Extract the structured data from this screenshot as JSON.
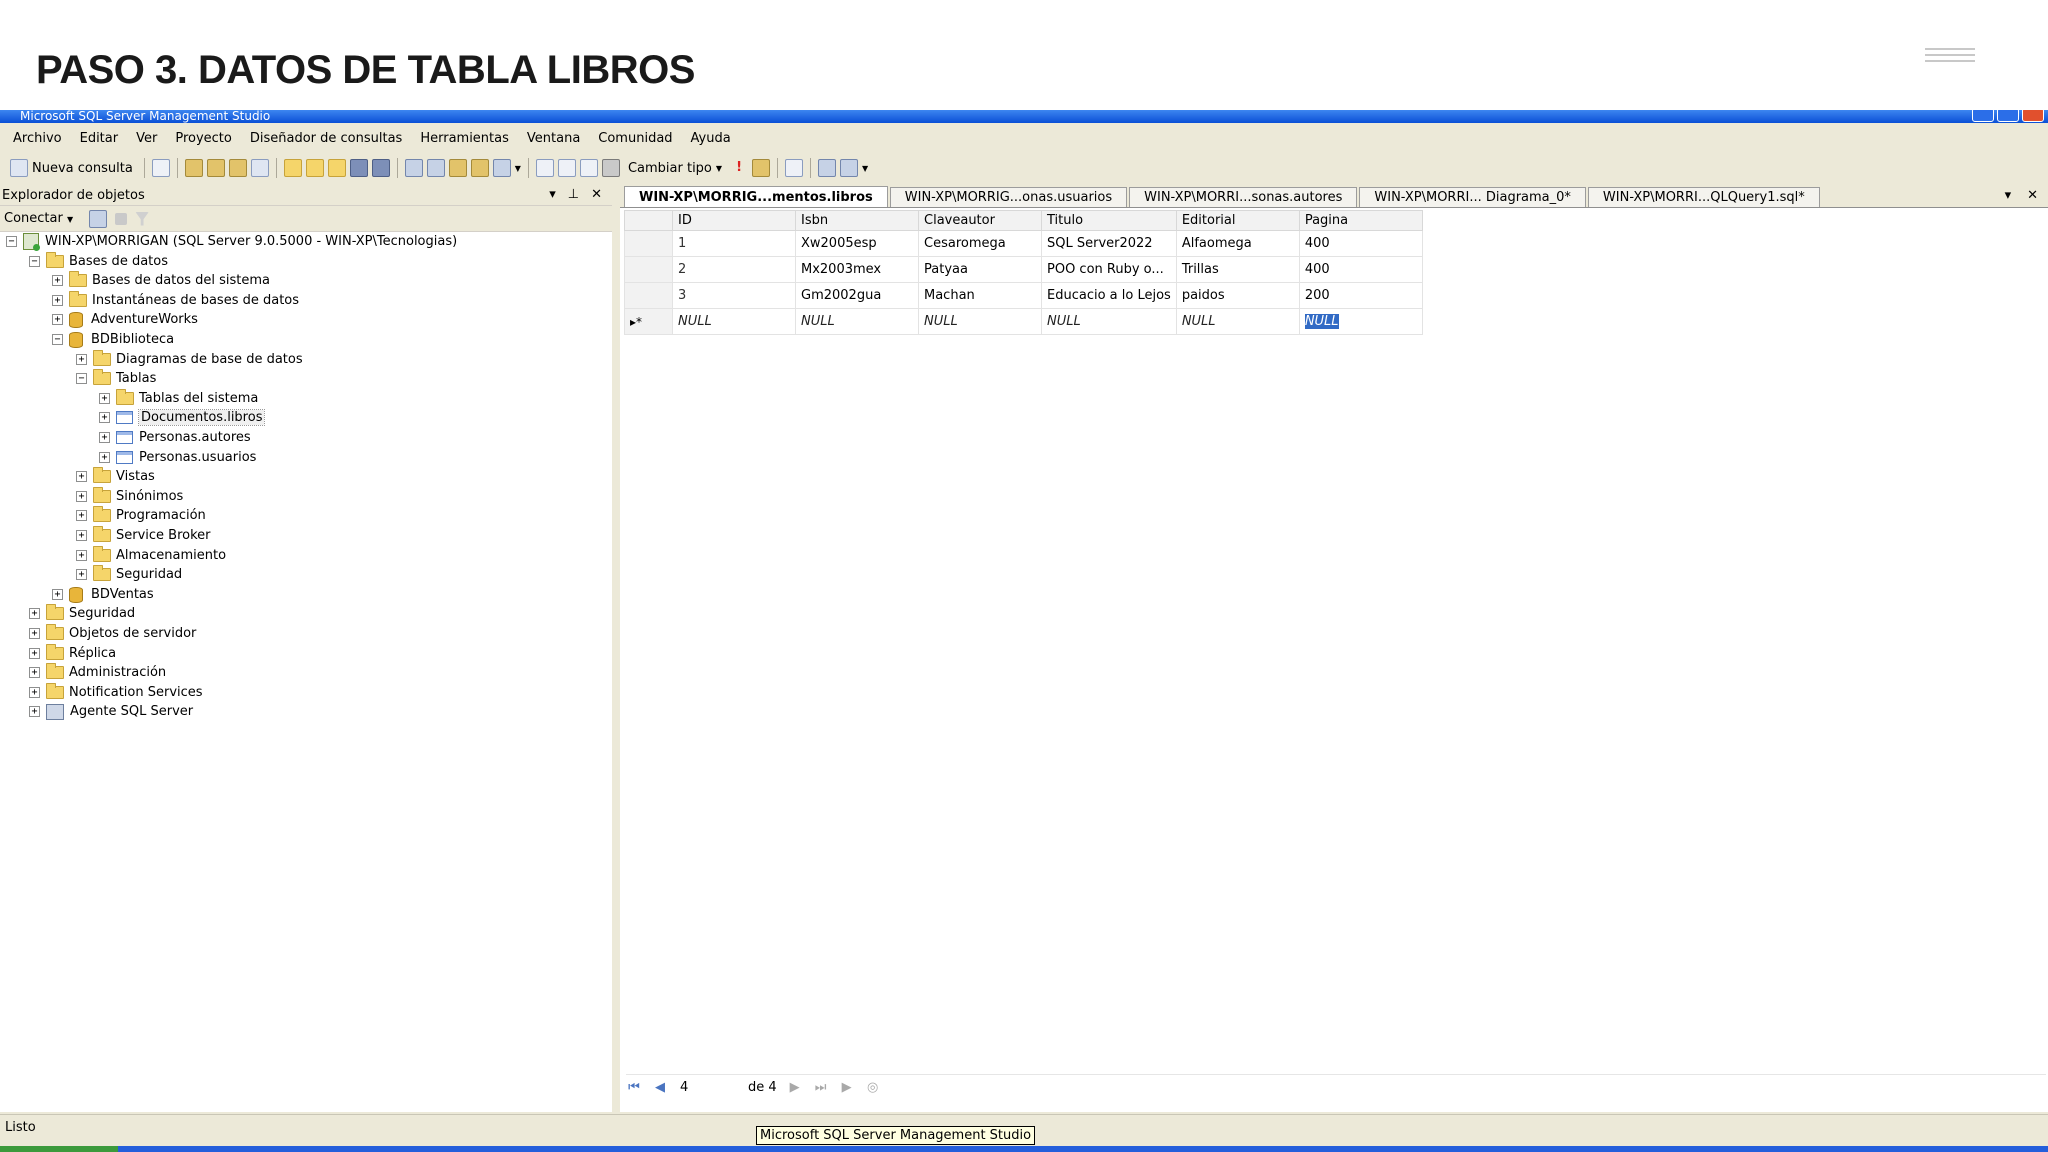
{
  "slide": {
    "title": "PASO 3. DATOS DE TABLA LIBROS"
  },
  "app": {
    "title": "Microsoft SQL Server Management Studio"
  },
  "menu": [
    "Archivo",
    "Editar",
    "Ver",
    "Proyecto",
    "Diseñador de consultas",
    "Herramientas",
    "Ventana",
    "Comunidad",
    "Ayuda"
  ],
  "toolbar": {
    "new_query": "Nueva consulta",
    "change_type": "Cambiar tipo"
  },
  "explorer": {
    "title": "Explorador de objetos",
    "connect": "Conectar",
    "server": "WIN-XP\\MORRIGAN (SQL Server 9.0.5000 - WIN-XP\\Tecnologias)",
    "databases": "Bases de datos",
    "system_dbs": "Bases de datos del sistema",
    "snapshots": "Instantáneas de bases de datos",
    "adventureworks": "AdventureWorks",
    "bdbiblioteca": "BDBiblioteca",
    "diagrams": "Diagramas de base de datos",
    "tables": "Tablas",
    "system_tables": "Tablas del sistema",
    "t_libros": "Documentos.libros",
    "t_autores": "Personas.autores",
    "t_usuarios": "Personas.usuarios",
    "views": "Vistas",
    "synonyms": "Sinónimos",
    "programming": "Programación",
    "service_broker": "Service Broker",
    "storage": "Almacenamiento",
    "db_security": "Seguridad",
    "bdventas": "BDVentas",
    "security": "Seguridad",
    "server_objects": "Objetos de servidor",
    "replication": "Réplica",
    "management": "Administración",
    "notification": "Notification Services",
    "agent": "Agente SQL Server"
  },
  "tabs": [
    "WIN-XP\\MORRIG...mentos.libros",
    "WIN-XP\\MORRIG...onas.usuarios",
    "WIN-XP\\MORRI...sonas.autores",
    "WIN-XP\\MORRI... Diagrama_0*",
    "WIN-XP\\MORRI...QLQuery1.sql*"
  ],
  "grid": {
    "columns": [
      "ID",
      "Isbn",
      "Claveautor",
      "Titulo",
      "Editorial",
      "Pagina"
    ],
    "rows": [
      [
        "1",
        "Xw2005esp",
        "Cesaromega",
        "SQL Server2022",
        "Alfaomega",
        "400"
      ],
      [
        "2",
        "Mx2003mex",
        "Patyaa",
        "POO con Ruby o...",
        "Trillas",
        "400"
      ],
      [
        "3",
        "Gm2002gua",
        "Machan",
        "Educacio a lo Lejos",
        "paidos",
        "200"
      ]
    ],
    "new_row_marker": "▸*",
    "null_text": "NULL"
  },
  "nav": {
    "record": "4",
    "of_label": "de 4"
  },
  "status": {
    "text": "Listo",
    "tooltip": "Microsoft SQL Server Management Studio"
  }
}
